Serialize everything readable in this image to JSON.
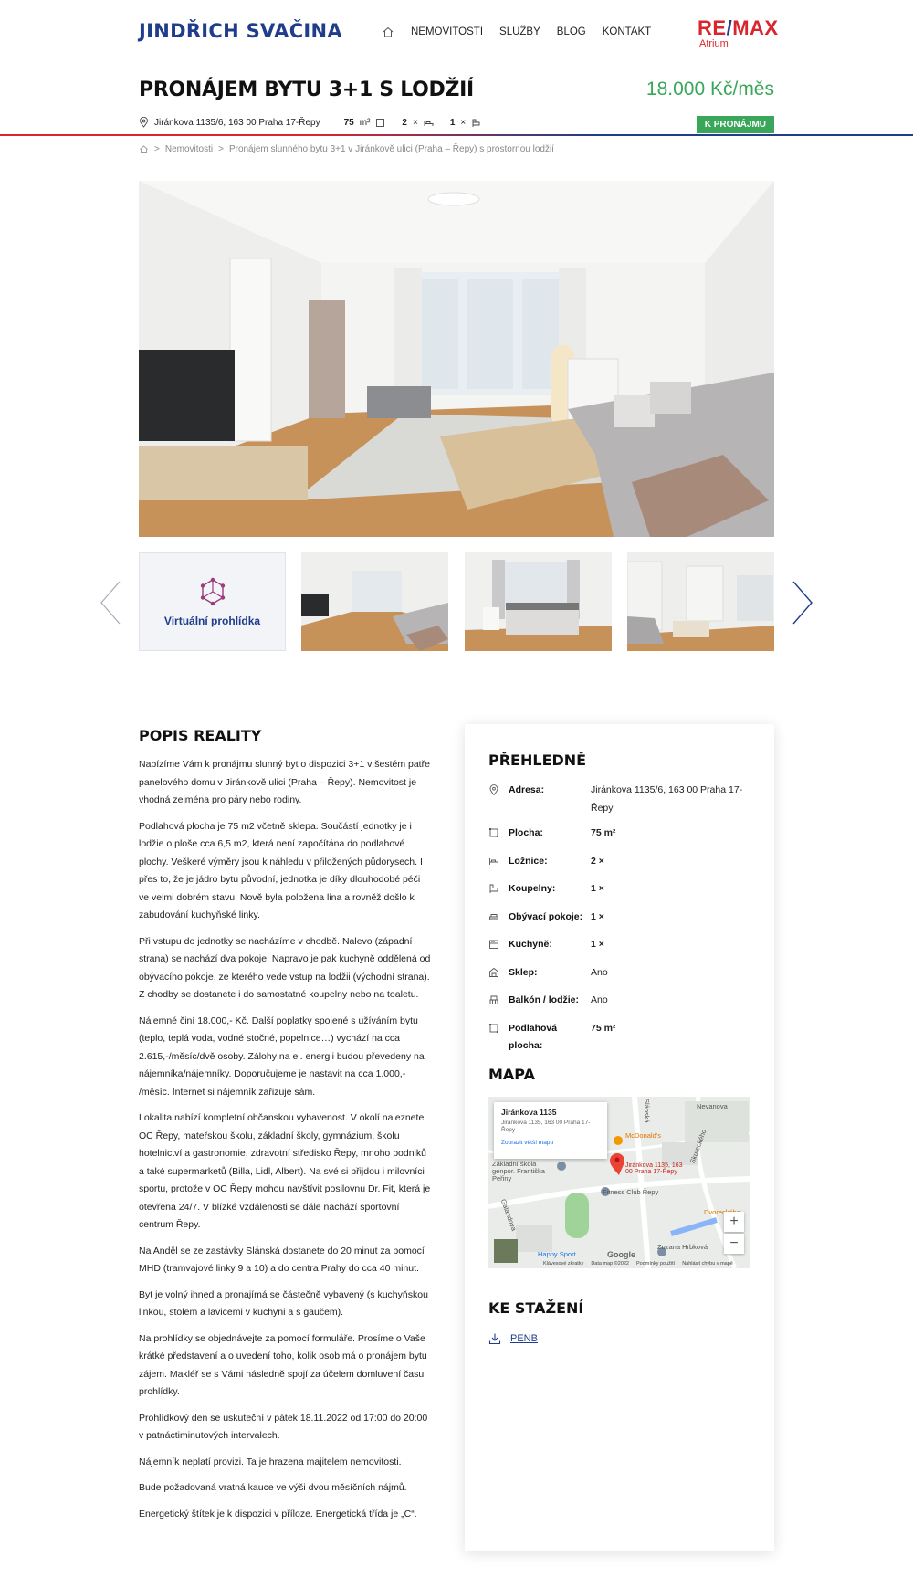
{
  "header": {
    "logo": "JINDŘICH SVAČINA",
    "nav": [
      "NEMOVITOSTI",
      "SLUŽBY",
      "BLOG",
      "KONTAKT"
    ],
    "brand_main": "RE",
    "brand_slash": "/",
    "brand_end": "MAX",
    "brand_sub": "Atrium"
  },
  "listing": {
    "title": "PRONÁJEM BYTU 3+1 S LODŽIÍ",
    "price": "18.000 Kč/měs",
    "address": "Jiránkova 1135/6, 163 00 Praha 17-Řepy",
    "area": "75",
    "area_unit": "m²",
    "bedrooms": "2",
    "bathrooms": "1",
    "times": "×",
    "badge": "K PRONÁJMU"
  },
  "breadcrumb": {
    "sep": ">",
    "items": [
      "Nemovitosti",
      "Pronájem slunného bytu 3+1 v Jiránkově ulici (Praha – Řepy) s prostornou lodžií"
    ]
  },
  "gallery": {
    "virtual_label": "Virtuální prohlídka"
  },
  "description": {
    "title": "POPIS REALITY",
    "paragraphs": [
      "Nabízíme Vám k pronájmu slunný byt o dispozici 3+1 v šestém patře panelového domu v Jiránkově ulici (Praha – Řepy). Nemovitost je vhodná zejména pro páry nebo rodiny.",
      "Podlahová plocha je 75 m2 včetně sklepa. Součástí jednotky je i lodžie o ploše cca 6,5 m2, která není započítána do podlahové plochy. Veškeré výměry jsou k náhledu v přiložených půdorysech. I přes to, že je jádro bytu původní, jednotka je díky dlouhodobé péči ve velmi dobrém stavu. Nově byla položena lina a rovněž došlo k zabudování kuchyňské linky.",
      "Při vstupu do jednotky se nacházíme v chodbě. Nalevo (západní strana) se nachází dva pokoje. Napravo je pak kuchyně oddělená od obývacího pokoje, ze kterého vede vstup na lodžii (východní strana). Z chodby se dostanete i do samostatné koupelny nebo na toaletu.",
      "Nájemné činí 18.000,- Kč. Další poplatky spojené s užíváním bytu (teplo, teplá voda, vodné stočné, popelnice…) vychází na cca 2.615,-/měsíc/dvě osoby. Zálohy na el. energii budou převedeny na nájemníka/nájemníky. Doporučujeme je nastavit na cca 1.000,- /měsíc. Internet si nájemník zařizuje sám.",
      "Lokalita nabízí kompletní občanskou vybavenost. V okolí naleznete OC Řepy, mateřskou školu, základní školy, gymnázium, školu hotelnictví a gastronomie, zdravotní středisko Řepy, mnoho podniků a také supermarketů (Billa, Lidl, Albert). Na své si přijdou i milovníci sportu, protože v OC Řepy mohou navštívit posilovnu Dr. Fit, která je otevřena 24/7. V blízké vzdálenosti se dále nachází sportovní centrum Řepy.",
      "Na Anděl se ze zastávky Slánská dostanete do 20 minut za pomocí MHD (tramvajové linky 9 a 10) a do centra Prahy do cca 40 minut.",
      "Byt je volný ihned a pronajímá se částečně vybavený (s kuchyňskou linkou, stolem a lavicemi v kuchyni a s gaučem).",
      "Na prohlídky se objednávejte za pomocí formuláře. Prosíme o Vaše krátké představení a o uvedení toho, kolik osob má o pronájem bytu zájem. Makléř se s Vámi následně spojí za účelem domluvení času prohlídky.",
      "Prohlídkový den se uskuteční v pátek 18.11.2022 od 17:00 do 20:00 v patnáctiminutových intervalech.",
      "Nájemník neplatí provizi. Ta je hrazena majitelem nemovitosti.",
      "Bude požadovaná vratná kauce ve výši dvou měsíčních nájmů.",
      "Energetický štítek je k dispozici v příloze. Energetická třída je „C“."
    ]
  },
  "overview": {
    "title": "PŘEHLEDNĚ",
    "rows": [
      {
        "icon": "pin-icon",
        "label": "Adresa:",
        "value": "Jiránkova 1135/6, 163 00 Praha 17-Řepy"
      },
      {
        "icon": "area-icon",
        "label": "Plocha:",
        "value": "75 m²"
      },
      {
        "icon": "bed-icon",
        "label": "Ložnice:",
        "value": "2 ×"
      },
      {
        "icon": "bath-icon",
        "label": "Koupelny:",
        "value": "1 ×"
      },
      {
        "icon": "sofa-icon",
        "label": "Obývací pokoje:",
        "value": "1 ×"
      },
      {
        "icon": "kitchen-icon",
        "label": "Kuchyně:",
        "value": "1 ×"
      },
      {
        "icon": "cellar-icon",
        "label": "Sklep:",
        "value": "Ano"
      },
      {
        "icon": "balcony-icon",
        "label": "Balkón / lodžie:",
        "value": "Ano"
      },
      {
        "icon": "area-icon",
        "label": "Podlahová plocha:",
        "value": "75 m²"
      }
    ]
  },
  "map": {
    "title": "MAPA",
    "popup_title": "Jiránkova 1135",
    "popup_address": "Jiránkova 1135, 163 00 Praha 17-Řepy",
    "popup_link": "Zobrazit větší mapu",
    "marker_label": "Jiránkova 1135, 163 00 Praha 17-Řepy",
    "places": [
      "McDonald's",
      "Fitness Club Řepy",
      "Happy Sport",
      "Zuzana Hrbková",
      "Základní škola genpor. Františka Peřiny",
      "Nevanova",
      "Skuteckého",
      "Galandova",
      "Dvoreckého",
      "Slánská"
    ],
    "zoom_in": "+",
    "zoom_out": "−",
    "footer": [
      "Klávesové zkratky",
      "Data map ©2022",
      "Podmínky použití",
      "Nahlásit chybu v mapě"
    ],
    "google": "Google"
  },
  "downloads": {
    "title": "KE STAŽENÍ",
    "items": [
      "PENB"
    ]
  },
  "colors": {
    "brand_blue": "#1f3d8a",
    "brand_red": "#d9262e",
    "accent_green": "#3aa65a"
  }
}
